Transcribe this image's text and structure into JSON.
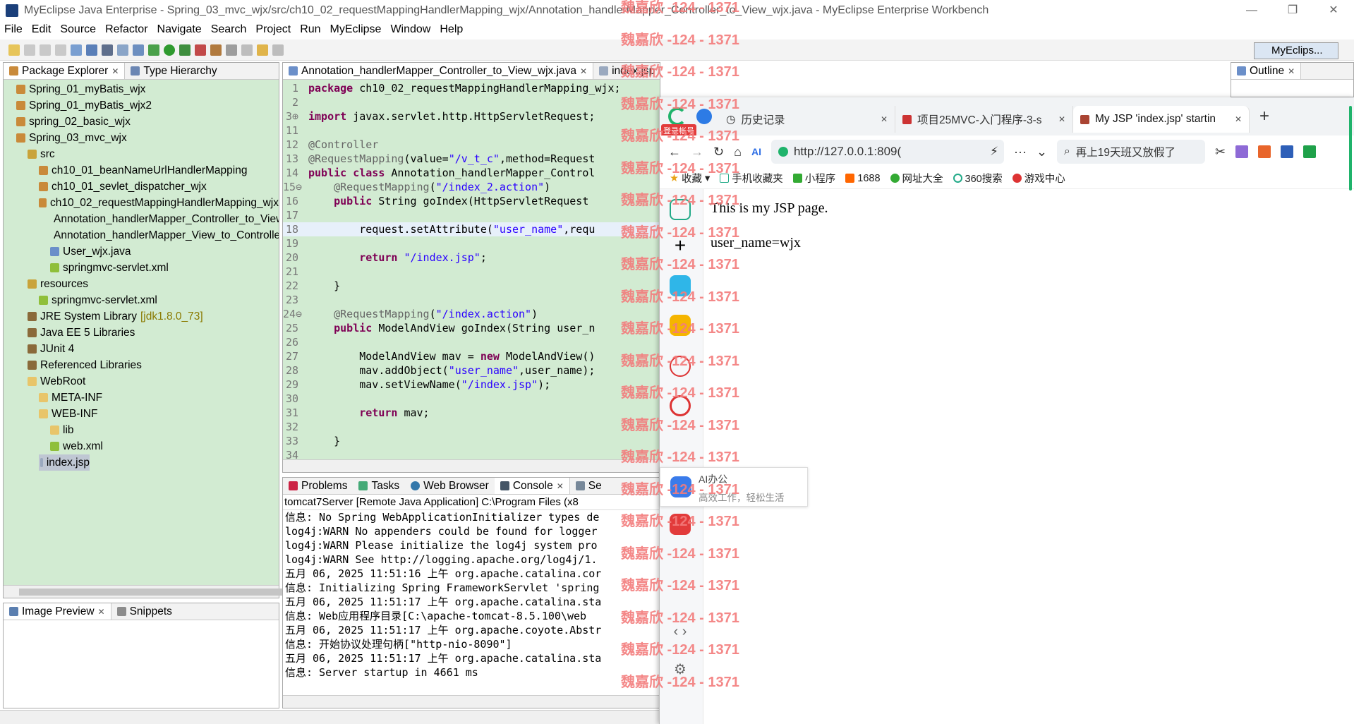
{
  "window": {
    "title": "MyEclipse Java Enterprise - Spring_03_mvc_wjx/src/ch10_02_requestMappingHandlerMapping_wjx/Annotation_handlerMapper_Controller_to_View_wjx.java - MyEclipse Enterprise Workbench",
    "controls": [
      "—",
      "❐",
      "✕"
    ]
  },
  "menu": [
    "File",
    "Edit",
    "Source",
    "Refactor",
    "Navigate",
    "Search",
    "Project",
    "Run",
    "MyEclipse",
    "Window",
    "Help"
  ],
  "perspective": "MyEclips...",
  "package_explorer": {
    "tabs": [
      "Package Explorer",
      "Type Hierarchy"
    ],
    "items": [
      {
        "label": "Spring_01_myBatis_wjx",
        "indent": 1,
        "icon": "project"
      },
      {
        "label": "Spring_01_myBatis_wjx2",
        "indent": 1,
        "icon": "project"
      },
      {
        "label": "spring_02_basic_wjx",
        "indent": 1,
        "icon": "project"
      },
      {
        "label": "Spring_03_mvc_wjx",
        "indent": 1,
        "icon": "project"
      },
      {
        "label": "src",
        "indent": 2,
        "icon": "source-folder"
      },
      {
        "label": "ch10_01_beanNameUrlHandlerMapping",
        "indent": 3,
        "icon": "package"
      },
      {
        "label": "ch10_01_sevlet_dispatcher_wjx",
        "indent": 3,
        "icon": "package"
      },
      {
        "label": "ch10_02_requestMappingHandlerMapping_wjx",
        "indent": 3,
        "icon": "package"
      },
      {
        "label": "Annotation_handlerMapper_Controller_to_View_wjx",
        "indent": 4,
        "icon": "java-file"
      },
      {
        "label": "Annotation_handlerMapper_View_to_Controller_wjx",
        "indent": 4,
        "icon": "java-file"
      },
      {
        "label": "User_wjx.java",
        "indent": 4,
        "icon": "java-file"
      },
      {
        "label": "springmvc-servlet.xml",
        "indent": 4,
        "icon": "xml-file"
      },
      {
        "label": "resources",
        "indent": 2,
        "icon": "source-folder"
      },
      {
        "label": "springmvc-servlet.xml",
        "indent": 3,
        "icon": "xml-file"
      },
      {
        "label": "JRE System Library",
        "suffix": "[jdk1.8.0_73]",
        "indent": 2,
        "icon": "library"
      },
      {
        "label": "Java EE 5 Libraries",
        "indent": 2,
        "icon": "library"
      },
      {
        "label": "JUnit 4",
        "indent": 2,
        "icon": "library"
      },
      {
        "label": "Referenced Libraries",
        "indent": 2,
        "icon": "library"
      },
      {
        "label": "WebRoot",
        "indent": 2,
        "icon": "folder"
      },
      {
        "label": "META-INF",
        "indent": 3,
        "icon": "folder"
      },
      {
        "label": "WEB-INF",
        "indent": 3,
        "icon": "folder"
      },
      {
        "label": "lib",
        "indent": 4,
        "icon": "folder"
      },
      {
        "label": "web.xml",
        "indent": 4,
        "icon": "xml-file"
      },
      {
        "label": "index.jsp",
        "indent": 3,
        "icon": "jsp-file",
        "selected": true
      }
    ]
  },
  "image_preview": {
    "tabs": [
      "Image Preview",
      "Snippets"
    ]
  },
  "editor": {
    "tabs": [
      "Annotation_handlerMapper_Controller_to_View_wjx.java",
      "index.jsp"
    ],
    "lines": [
      {
        "n": "1",
        "html": "<span class='kw'>package</span> ch10_02_requestMappingHandlerMapping_wjx;"
      },
      {
        "n": "2",
        "html": ""
      },
      {
        "n": "3⊕",
        "html": "<span class='kw'>import</span> javax.servlet.http.HttpServletRequest;"
      },
      {
        "n": "11",
        "html": ""
      },
      {
        "n": "12",
        "html": "<span class='ann'>@Controller</span>"
      },
      {
        "n": "13",
        "html": "<span class='ann'>@RequestMapping</span>(value=<span class='str'>\"/v_t_c\"</span>,method=Request"
      },
      {
        "n": "14",
        "html": "<span class='kw'>public class</span> Annotation_handlerMapper_Control"
      },
      {
        "n": "15⊖",
        "html": "    <span class='ann'>@RequestMapping</span>(<span class='str'>\"/index_2.action\"</span>)"
      },
      {
        "n": "16",
        "html": "    <span class='kw'>public</span> String goIndex(HttpServletRequest"
      },
      {
        "n": "17",
        "html": ""
      },
      {
        "n": "18",
        "html": "        request.setAttribute(<span class='str'>\"user_name\"</span>,requ",
        "hl": true
      },
      {
        "n": "19",
        "html": ""
      },
      {
        "n": "20",
        "html": "        <span class='kw'>return</span> <span class='str'>\"/index.jsp\"</span>;"
      },
      {
        "n": "21",
        "html": ""
      },
      {
        "n": "22",
        "html": "    }"
      },
      {
        "n": "23",
        "html": ""
      },
      {
        "n": "24⊖",
        "html": "    <span class='ann'>@RequestMapping</span>(<span class='str'>\"/index.action\"</span>)"
      },
      {
        "n": "25",
        "html": "    <span class='kw'>public</span> ModelAndView goIndex(String user_n"
      },
      {
        "n": "26",
        "html": ""
      },
      {
        "n": "27",
        "html": "        ModelAndView mav = <span class='kw'>new</span> ModelAndView()"
      },
      {
        "n": "28",
        "html": "        mav.addObject(<span class='str'>\"user_name\"</span>,user_name);"
      },
      {
        "n": "29",
        "html": "        mav.setViewName(<span class='str'>\"/index.jsp\"</span>);"
      },
      {
        "n": "30",
        "html": ""
      },
      {
        "n": "31",
        "html": "        <span class='kw'>return</span> mav;"
      },
      {
        "n": "32",
        "html": ""
      },
      {
        "n": "33",
        "html": "    }"
      },
      {
        "n": "34",
        "html": ""
      }
    ]
  },
  "console": {
    "tabs": [
      "Problems",
      "Tasks",
      "Web Browser",
      "Console",
      "Se"
    ],
    "header": "tomcat7Server [Remote Java Application] C:\\Program Files (x8",
    "lines": [
      "信息: No Spring WebApplicationInitializer types de",
      "log4j:WARN No appenders could be found for logger",
      "log4j:WARN Please initialize the log4j system pro",
      "log4j:WARN See http://logging.apache.org/log4j/1.",
      "五月 06, 2025 11:51:16 上午 org.apache.catalina.cor",
      "信息: Initializing Spring FrameworkServlet 'spring",
      "五月 06, 2025 11:51:17 上午 org.apache.catalina.sta",
      "信息: Web应用程序目录[C:\\apache-tomcat-8.5.100\\web",
      "五月 06, 2025 11:51:17 上午 org.apache.coyote.Abstr",
      "信息: 开始协议处理句柄[\"http-nio-8090\"]",
      "五月 06, 2025 11:51:17 上午 org.apache.catalina.sta",
      "信息: Server startup in 4661 ms"
    ]
  },
  "outline": {
    "tab": "Outline"
  },
  "browser": {
    "tabs": [
      "历史记录",
      "项目25MVC-入门程序-3-s",
      "My JSP 'index.jsp' startin"
    ],
    "login_badge": "登录帐号",
    "url": "http://127.0.0.1:809(",
    "search_placeholder": "再上19天班又放假了",
    "bookmarks": [
      "收藏",
      "手机收藏夹",
      "小程序",
      "1688",
      "网址大全",
      "360搜索",
      "游戏中心"
    ],
    "content": [
      "This is my JSP page.",
      "user_name=wjx"
    ],
    "ai_tip_title": "AI办公",
    "ai_tip_sub": "高效工作，轻松生活"
  },
  "watermark": "魏嘉欣 -124 - 1371",
  "colors": {
    "editor_bg": "#d2ebd2",
    "keyword": "#7f0055",
    "string": "#2a00ff",
    "watermark": "#f37c7c"
  }
}
